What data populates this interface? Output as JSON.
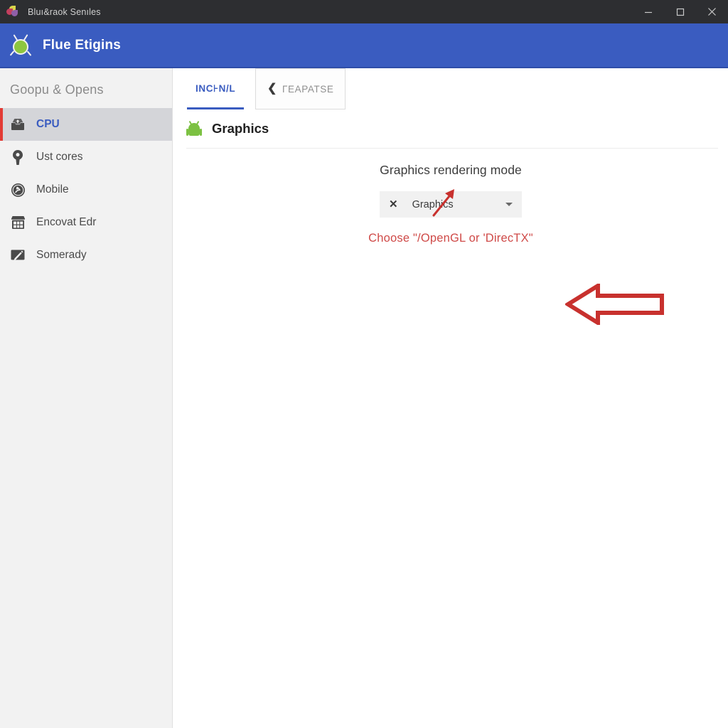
{
  "titlebar": {
    "title": "Bluı&raok Senıles",
    "icon": "app-logo-icon",
    "controls": [
      {
        "name": "minimize",
        "glyph": "minimize-icon"
      },
      {
        "name": "maximize",
        "glyph": "maximize-icon"
      },
      {
        "name": "close",
        "glyph": "close-icon"
      }
    ]
  },
  "appheader": {
    "title": "Flue Etigins",
    "logo": "android-bug-logo-icon",
    "bg_color": "#3a5cc0"
  },
  "sidebar": {
    "header": "Goopu & Opens",
    "accent_color": "#e23b35",
    "selected_bg": "#d4d5d9",
    "selected_text_color": "#3a5cc0",
    "items": [
      {
        "label": "CPU",
        "icon": "inbox-upload-icon",
        "selected": true
      },
      {
        "label": "Ust cores",
        "icon": "location-pin-icon",
        "selected": false
      },
      {
        "label": "Mobile",
        "icon": "circle-badge-icon",
        "selected": false
      },
      {
        "label": "Encovat Edr",
        "icon": "storefront-icon",
        "selected": false
      },
      {
        "label": "Somerady",
        "icon": "pen-screen-icon",
        "selected": false
      }
    ]
  },
  "content": {
    "tabs": [
      {
        "label": "INC⊦N/L",
        "active": true,
        "chevron": ""
      },
      {
        "label": "ΓEAPATSE",
        "active": false,
        "chevron": "❮"
      }
    ],
    "section": {
      "icon": "android-robot-icon",
      "title": "Graphics"
    },
    "setting": {
      "label": "Graphics rendering mode",
      "dropdown": {
        "clear_glyph": "✕",
        "value": "Graphics",
        "caret": "chevron-down-icon"
      }
    },
    "annotations": {
      "text": "Choose \"/OpenGL  or 'DirecTX\"",
      "text_color": "#cf4a48",
      "small_arrow": "small-red-arrow-up-right",
      "big_arrow": "big-red-arrow-left"
    }
  }
}
